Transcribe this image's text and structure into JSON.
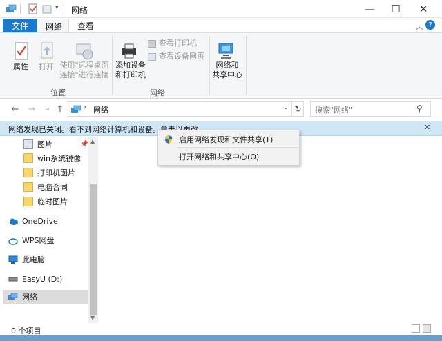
{
  "window": {
    "title": "网络"
  },
  "ribbon": {
    "tabs": {
      "file": "文件",
      "network": "网络",
      "view": "查看"
    },
    "buttons": {
      "properties": "属性",
      "open": "打开",
      "remote_desktop_line1": "使用\"远程桌面",
      "remote_desktop_line2": "连接\"进行连接",
      "view_printers": "查看打印机",
      "view_device_page": "查看设备网页",
      "add_device_line1": "添加设备",
      "add_device_line2": "和打印机",
      "network_center_line1": "网络和",
      "network_center_line2": "共享中心"
    },
    "groups": {
      "location": "位置",
      "network": "网络"
    }
  },
  "address": {
    "path": "网络",
    "search_placeholder": "搜索\"网络\""
  },
  "infobar": {
    "message": "网络发现已关闭。看不到网络计算机和设备。单击以更改..."
  },
  "context_menu": {
    "items": [
      "启用网络发现和文件共享(T)",
      "打开网络和共享中心(O)"
    ]
  },
  "nav": {
    "items": [
      {
        "label": "图片",
        "pinned": true
      },
      {
        "label": "win系统镜像"
      },
      {
        "label": "打印机图片"
      },
      {
        "label": "电脑合同"
      },
      {
        "label": "临时图片"
      },
      {
        "label": "OneDrive"
      },
      {
        "label": "WPS网盘"
      },
      {
        "label": "此电脑"
      },
      {
        "label": "EasyU (D:)"
      },
      {
        "label": "网络",
        "selected": true
      }
    ]
  },
  "status": {
    "count": "0 个项目"
  },
  "colors": {
    "accent": "#1979ca",
    "infobar": "#cfe6f5",
    "folder": "#f7d66a"
  }
}
